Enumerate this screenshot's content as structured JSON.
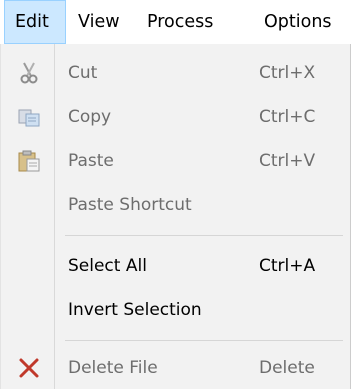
{
  "menubar": {
    "items": [
      {
        "label": "Edit",
        "active": true
      },
      {
        "label": "View"
      },
      {
        "label": "Process"
      },
      {
        "label": "Options"
      }
    ]
  },
  "edit_menu": {
    "items": [
      {
        "label": "Cut",
        "shortcut": "Ctrl+X",
        "icon": "scissors-icon",
        "enabled": false
      },
      {
        "label": "Copy",
        "shortcut": "Ctrl+C",
        "icon": "copy-icon",
        "enabled": false
      },
      {
        "label": "Paste",
        "shortcut": "Ctrl+V",
        "icon": "clipboard-paste-icon",
        "enabled": false
      },
      {
        "label": "Paste Shortcut",
        "shortcut": "",
        "enabled": false
      },
      {
        "label": "Select All",
        "shortcut": "Ctrl+A",
        "enabled": true
      },
      {
        "label": "Invert Selection",
        "shortcut": "",
        "enabled": true
      },
      {
        "label": "Delete File",
        "shortcut": "Delete",
        "icon": "delete-x-icon",
        "enabled": false
      }
    ]
  },
  "colors": {
    "active_menu_bg": "#cce8ff",
    "active_menu_border": "#99d1ff",
    "dropdown_bg": "#f2f2f2",
    "disabled_text": "#6d6d6d",
    "delete_icon": "#c0392b"
  }
}
